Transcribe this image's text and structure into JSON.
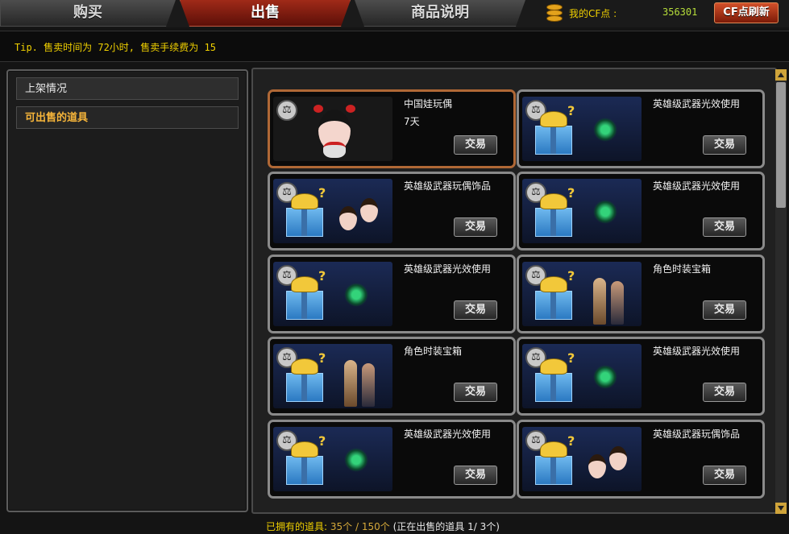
{
  "tabs": [
    {
      "label": "购买"
    },
    {
      "label": "出售"
    },
    {
      "label": "商品说明"
    }
  ],
  "points": {
    "label": "我的CF点 :",
    "value": "356301",
    "refresh_label": "CF点刷新"
  },
  "tip": "Tip. 售卖时间为 72小时, 售卖手续费为 15",
  "sidebar": {
    "items": [
      {
        "label": "上架情况"
      },
      {
        "label": "可出售的道具"
      }
    ]
  },
  "items": [
    {
      "name": "中国娃玩偶",
      "sub": "7天",
      "trade": "交易",
      "art": "doll"
    },
    {
      "name": "英雄级武器光效使用",
      "sub": "",
      "trade": "交易",
      "art": "effect"
    },
    {
      "name": "英雄级武器玩偶饰品",
      "sub": "",
      "trade": "交易",
      "art": "dolls"
    },
    {
      "name": "英雄级武器光效使用",
      "sub": "",
      "trade": "交易",
      "art": "effect"
    },
    {
      "name": "英雄级武器光效使用",
      "sub": "",
      "trade": "交易",
      "art": "effect"
    },
    {
      "name": "角色时装宝箱",
      "sub": "",
      "trade": "交易",
      "art": "figures"
    },
    {
      "name": "角色时装宝箱",
      "sub": "",
      "trade": "交易",
      "art": "figures"
    },
    {
      "name": "英雄级武器光效使用",
      "sub": "",
      "trade": "交易",
      "art": "effect"
    },
    {
      "name": "英雄级武器光效使用",
      "sub": "",
      "trade": "交易",
      "art": "effect"
    },
    {
      "name": "英雄级武器玩偶饰品",
      "sub": "",
      "trade": "交易",
      "art": "dolls"
    }
  ],
  "footer": {
    "owned_label": "已拥有的道具:",
    "owned_value": "35个 / 150个",
    "selling_label": "(正在出售的道具",
    "selling_value": "1/ 3个)"
  }
}
